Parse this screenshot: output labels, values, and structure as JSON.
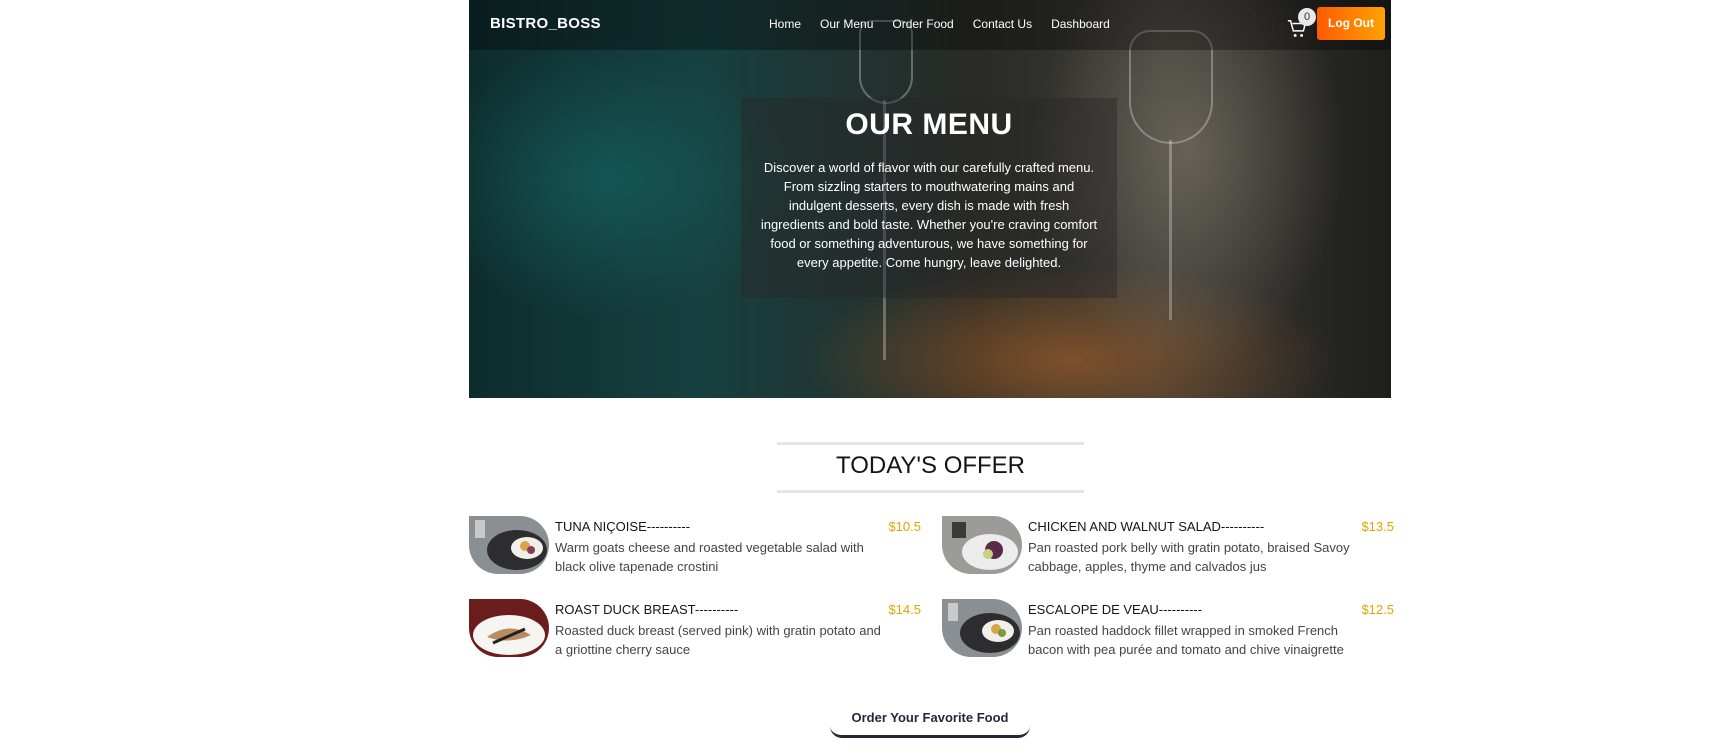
{
  "nav": {
    "brand": "BISTRO_BOSS",
    "links": [
      "Home",
      "Our Menu",
      "Order Food",
      "Contact Us",
      "Dashboard"
    ],
    "cart_count": "0",
    "logout_label": "Log Out",
    "accent_gradient": [
      "#ff5a00",
      "#ffa300"
    ]
  },
  "hero": {
    "title": "OUR MENU",
    "description": "Discover a world of flavor with our carefully crafted menu. From sizzling starters to mouthwatering mains and indulgent desserts, every dish is made with fresh ingredients and bold taste. Whether you're craving comfort food or something adventurous, we have something for every appetite. Come hungry, leave delighted."
  },
  "offer": {
    "heading": "TODAY'S OFFER",
    "items": [
      {
        "name": "TUNA NIÇOISE----------",
        "price": "$10.5",
        "description": "Warm goats cheese and roasted vegetable salad with black olive tapenade crostini"
      },
      {
        "name": "CHICKEN AND WALNUT SALAD----------",
        "price": "$13.5",
        "description": "Pan roasted pork belly with gratin potato, braised Savoy cabbage, apples, thyme and calvados jus"
      },
      {
        "name": "ROAST DUCK BREAST----------",
        "price": "$14.5",
        "description": "Roasted duck breast (served pink) with gratin potato and a griottine cherry sauce"
      },
      {
        "name": "ESCALOPE DE VEAU----------",
        "price": "$12.5",
        "description": "Pan roasted haddock fillet wrapped in smoked French bacon with pea purée and tomato and chive vinaigrette"
      }
    ],
    "price_color": "#e0a500",
    "cta_label": "Order Your Favorite Food"
  }
}
